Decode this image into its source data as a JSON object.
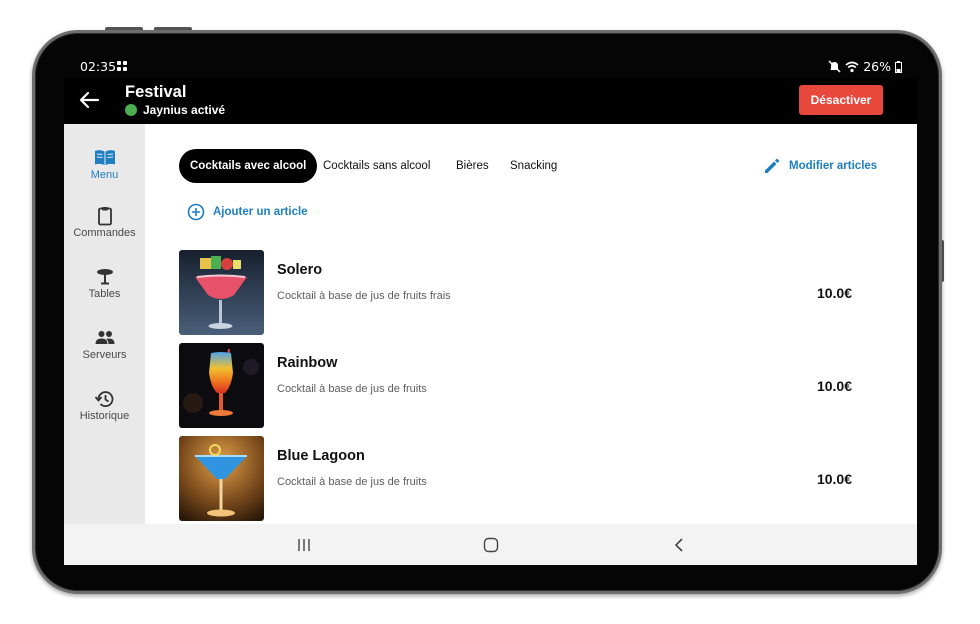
{
  "status_bar": {
    "time": "02:35",
    "battery": "26%"
  },
  "header": {
    "title": "Festival",
    "status": "Jaynius activé",
    "status_color": "#4caf50",
    "deactivate_label": "Désactiver",
    "deactivate_color": "#e8473c"
  },
  "sidebar": {
    "items": [
      {
        "label": "Menu",
        "icon": "book-icon",
        "active": true
      },
      {
        "label": "Commandes",
        "icon": "clipboard-icon",
        "active": false
      },
      {
        "label": "Tables",
        "icon": "table-icon",
        "active": false
      },
      {
        "label": "Serveurs",
        "icon": "people-icon",
        "active": false
      },
      {
        "label": "Historique",
        "icon": "history-icon",
        "active": false
      }
    ]
  },
  "tabs": [
    {
      "label": "Cocktails avec alcool",
      "active": true
    },
    {
      "label": "Cocktails sans alcool",
      "active": false
    },
    {
      "label": "Bières",
      "active": false
    },
    {
      "label": "Snacking",
      "active": false
    }
  ],
  "actions": {
    "edit_label": "Modifier articles",
    "add_label": "Ajouter un article"
  },
  "articles": [
    {
      "name": "Solero",
      "description": "Cocktail à base de jus de fruits frais",
      "price": "10.0€"
    },
    {
      "name": "Rainbow",
      "description": "Cocktail à base de jus de fruits",
      "price": "10.0€"
    },
    {
      "name": "Blue Lagoon",
      "description": "Cocktail à base de jus de fruits",
      "price": "10.0€"
    }
  ],
  "theme": {
    "accent": "#1e7fc2",
    "sidebar_bg": "#e9e9e9"
  }
}
